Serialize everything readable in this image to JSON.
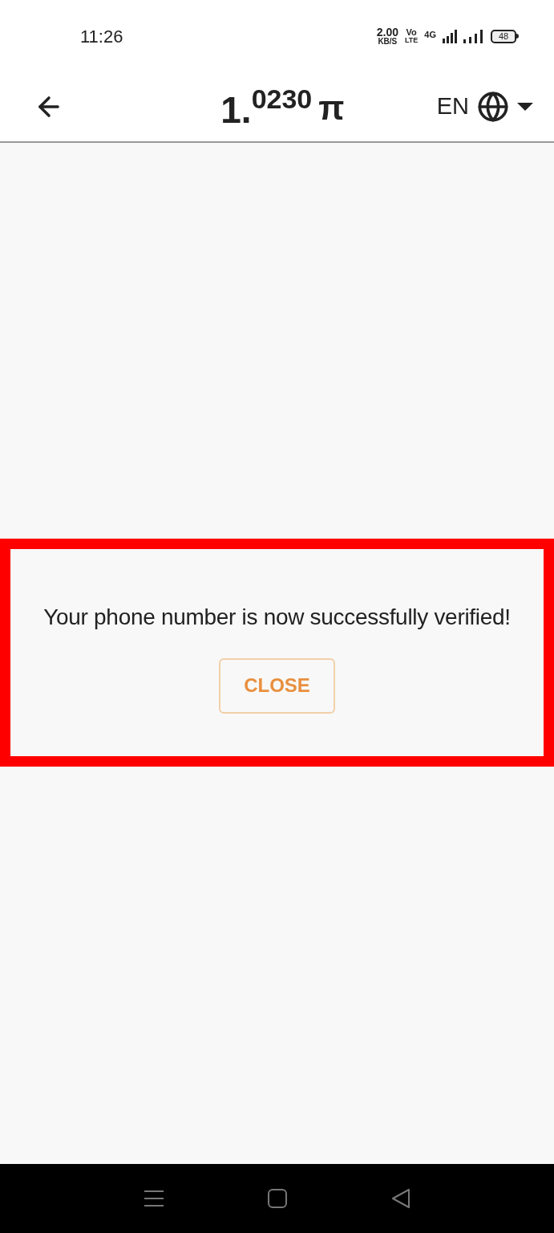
{
  "status_bar": {
    "time": "11:26",
    "speed_value": "2.00",
    "speed_unit": "KB/S",
    "volte_top": "Vo",
    "volte_bottom": "LTE",
    "network": "4G",
    "battery": "48"
  },
  "header": {
    "balance_whole": "1.",
    "balance_fraction": "0230",
    "currency": "π",
    "language": "EN"
  },
  "dialog": {
    "highlighted": true,
    "message": "Your phone number is now successfully verified!",
    "button": "CLOSE"
  }
}
